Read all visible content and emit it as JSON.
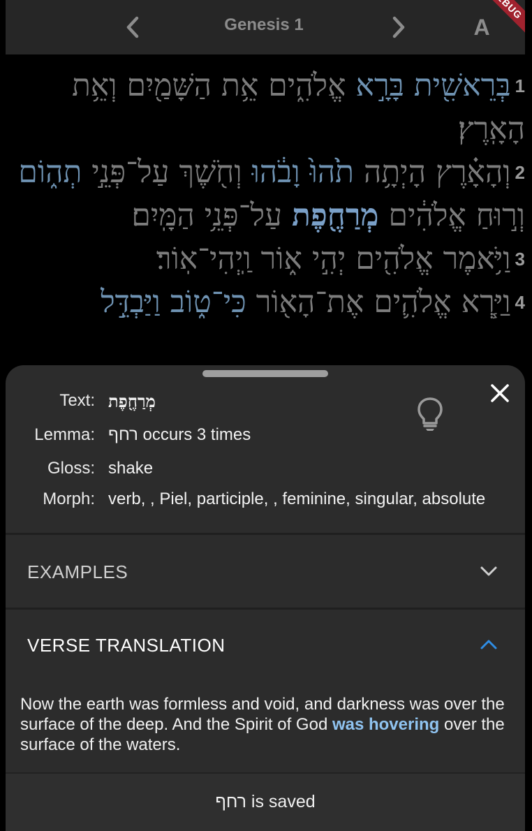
{
  "appbar": {
    "title": "Genesis 1",
    "font_button": "A",
    "debug_banner": "DEBUG"
  },
  "verses": [
    {
      "num": "1",
      "words": [
        {
          "t": "בְּרֵאשִׁ֖ית",
          "style": "blue"
        },
        {
          "t": "בָּרָ֣א",
          "style": "blue"
        },
        {
          "t": "אֱלֹהִ֑ים",
          "style": "plain"
        },
        {
          "t": "אֵ֥ת",
          "style": "plain"
        },
        {
          "t": "הַשָּׁמַ֖יִם",
          "style": "plain"
        },
        {
          "t": "וְאֵ֥ת",
          "style": "plain"
        },
        {
          "t": "הָאָֽרֶץ׃",
          "style": "plain"
        }
      ]
    },
    {
      "num": "2",
      "words": [
        {
          "t": "וְהָאָ֗רֶץ",
          "style": "plain"
        },
        {
          "t": "הָיְתָ֥ה",
          "style": "plain"
        },
        {
          "t": "תֹ֙הוּ֙",
          "style": "blue"
        },
        {
          "t": "וָבֹ֔הוּ",
          "style": "blue"
        },
        {
          "t": "וְחֹ֖שֶׁךְ",
          "style": "plain"
        },
        {
          "t": "עַל־פְּנֵ֣י",
          "style": "plain"
        },
        {
          "t": "תְה֑וֹם",
          "style": "blue"
        },
        {
          "t": "וְר֣וּחַ",
          "style": "plain"
        },
        {
          "t": "אֱלֹהִ֔ים",
          "style": "plain"
        },
        {
          "t": "מְרַחֶ֖פֶת",
          "style": "selected"
        },
        {
          "t": "עַל־פְּנֵ֥י",
          "style": "plain"
        },
        {
          "t": "הַמָּֽיִם׃",
          "style": "plain"
        }
      ]
    },
    {
      "num": "3",
      "words": [
        {
          "t": "וַיֹּ֥אמֶר",
          "style": "plain"
        },
        {
          "t": "אֱלֹהִ֖ים",
          "style": "plain"
        },
        {
          "t": "יְהִ֣י",
          "style": "plain"
        },
        {
          "t": "א֑וֹר",
          "style": "plain"
        },
        {
          "t": "וַֽיְהִי־אֽוֹר׃",
          "style": "plain"
        }
      ]
    },
    {
      "num": "4",
      "words": [
        {
          "t": "וַיַּ֧רְא",
          "style": "plain"
        },
        {
          "t": "אֱלֹהִ֛ים",
          "style": "plain"
        },
        {
          "t": "אֶת־הָא֖וֹר",
          "style": "plain"
        },
        {
          "t": "כִּי־ט֑וֹב",
          "style": "blue"
        },
        {
          "t": "וַיַּבְדֵּ֣ל",
          "style": "blue"
        }
      ]
    }
  ],
  "sheet": {
    "text_label": "Text:",
    "text_value": "מְרַחֶ֖פֶת",
    "lemma_label": "Lemma:",
    "lemma_value": "רחף occurs 3 times",
    "gloss_label": "Gloss:",
    "gloss_value": "shake",
    "morph_label": "Morph:",
    "morph_value": "verb, , Piel, participle, , feminine, singular, absolute",
    "examples_title": "EXAMPLES",
    "translation_title": "VERSE TRANSLATION",
    "translation_before": "Now the earth was formless and void, and darkness was over the surface of the deep. And the Spirit of God ",
    "translation_highlight": "was hovering",
    "translation_after": " over the surface of the waters.",
    "snackbar": "רחף is saved"
  },
  "colors": {
    "accent": "#2f8de4",
    "highlight": "#8fc3f0",
    "verse_blue": "#6f93b3",
    "sheet_bg": "#2c2c2c"
  },
  "icons": [
    "chevron-left-icon",
    "chevron-right-icon",
    "close-icon",
    "lightbulb-icon",
    "chevron-down-icon",
    "chevron-up-icon"
  ]
}
